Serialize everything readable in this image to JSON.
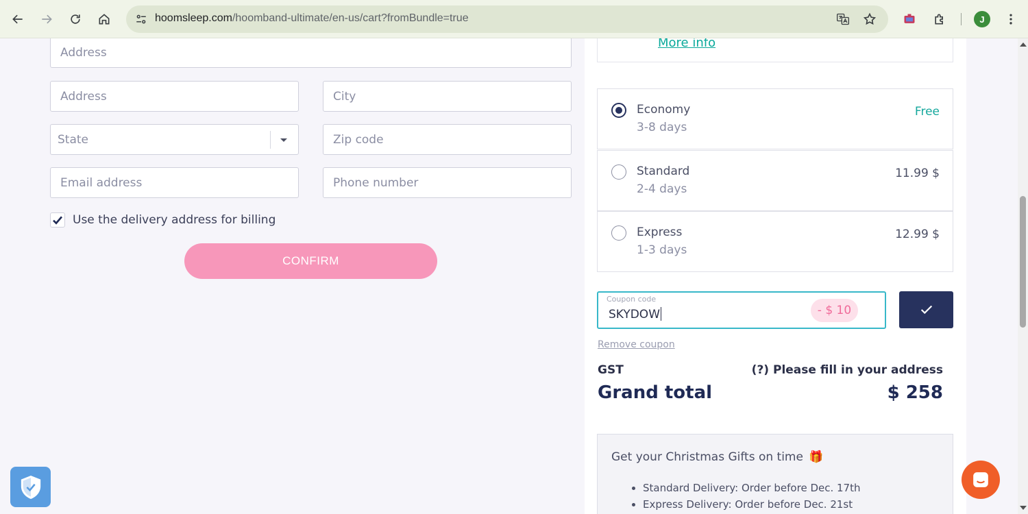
{
  "browser": {
    "url_domain": "hoomsleep.com",
    "url_path": "/hoomband-ultimate/en-us/cart?fromBundle=true",
    "profile_initial": "J",
    "icons": [
      "back-icon",
      "forward-icon",
      "reload-icon",
      "home-icon",
      "site-info-icon",
      "translate-icon",
      "bookmark-star-icon",
      "extension-icon",
      "puzzle-icon",
      "kebab-menu-icon"
    ]
  },
  "form": {
    "address1_placeholder": "Address",
    "address2_placeholder": "Address",
    "city_placeholder": "City",
    "state_placeholder": "State",
    "zip_placeholder": "Zip code",
    "email_placeholder": "Email address",
    "phone_placeholder": "Phone number",
    "billing_checkbox_label": "Use the delivery address for billing",
    "billing_checked": true,
    "confirm_label": "CONFIRM"
  },
  "product": {
    "more_info": "More info"
  },
  "shipping": {
    "options": [
      {
        "name": "Economy",
        "days": "3-8 days",
        "price": "Free",
        "selected": true
      },
      {
        "name": "Standard",
        "days": "2-4 days",
        "price": "11.99 $",
        "selected": false
      },
      {
        "name": "Express",
        "days": "1-3 days",
        "price": "12.99 $",
        "selected": false
      }
    ]
  },
  "coupon": {
    "label": "Coupon code",
    "value": "SKYDOW",
    "discount": "- $ 10",
    "remove_label": "Remove coupon"
  },
  "summary": {
    "gst_label": "GST",
    "gst_value": "(?) Please fill in your address",
    "grand_total_label": "Grand total",
    "grand_total_value": "$ 258"
  },
  "christmas": {
    "title": "Get your Christmas Gifts on time",
    "emoji": "🎁",
    "items": [
      "Standard Delivery: Order before Dec. 17th",
      "Express Delivery: Order before Dec. 21st"
    ]
  },
  "colors": {
    "accent_navy": "#27325e",
    "confirm_pink": "#f797ba",
    "teal": "#16a89d",
    "coupon_border": "#37b8c9",
    "chat_orange": "#f05e28"
  }
}
